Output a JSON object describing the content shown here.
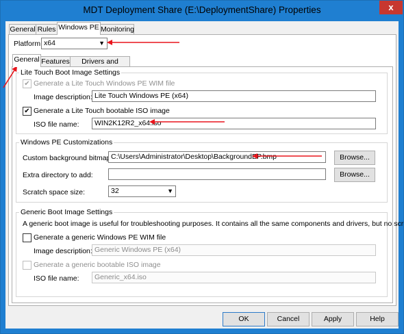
{
  "window": {
    "title": "MDT Deployment Share (E:\\DeploymentShare) Properties",
    "close_glyph": "x"
  },
  "top_tabs": [
    {
      "label": "General",
      "active": false
    },
    {
      "label": "Rules",
      "active": false
    },
    {
      "label": "Windows PE",
      "active": true
    },
    {
      "label": "Monitoring",
      "active": false
    }
  ],
  "platform": {
    "label": "Platform:",
    "value": "x64"
  },
  "sub_tabs": [
    {
      "label": "General",
      "active": true
    },
    {
      "label": "Features",
      "active": false
    },
    {
      "label": "Drivers and Patches",
      "active": false
    }
  ],
  "lite_touch": {
    "title": "Lite Touch Boot Image Settings",
    "generate_wim_label": "Generate a Lite Touch Windows PE WIM file",
    "image_description_label": "Image description:",
    "image_description_value": "Lite Touch Windows PE (x64)",
    "generate_iso_label": "Generate a Lite Touch bootable ISO image",
    "iso_name_label": "ISO file name:",
    "iso_name_value": "WIN2K12R2_x64.iso"
  },
  "customizations": {
    "title": "Windows PE Customizations",
    "background_label": "Custom background bitmap file:",
    "background_value": "C:\\Users\\Administrator\\Desktop\\BackgroundEP.bmp",
    "browse1_label": "Browse...",
    "extra_dir_label": "Extra directory to add:",
    "extra_dir_value": "",
    "browse2_label": "Browse...",
    "scratch_label": "Scratch space size:",
    "scratch_value": "32"
  },
  "generic": {
    "title": "Generic Boot Image Settings",
    "description": "A generic boot image is useful for troubleshooting purposes.  It contains all the same components and drivers, but no scripts.",
    "generate_wim_label": "Generate a generic Windows PE WIM file",
    "image_description_label": "Image description:",
    "image_description_value": "Generic Windows PE (x64)",
    "generate_iso_label": "Generate a generic bootable ISO image",
    "iso_name_label": "ISO file name:",
    "iso_name_value": "Generic_x64.iso"
  },
  "buttons": {
    "ok": "OK",
    "cancel": "Cancel",
    "apply": "Apply",
    "help": "Help"
  },
  "colors": {
    "annotation_arrow": "#e8141b",
    "title_bar": "#1f7fd1",
    "close_button": "#c7372f"
  },
  "icons": {
    "check": "✔",
    "dropdown": "▼"
  }
}
